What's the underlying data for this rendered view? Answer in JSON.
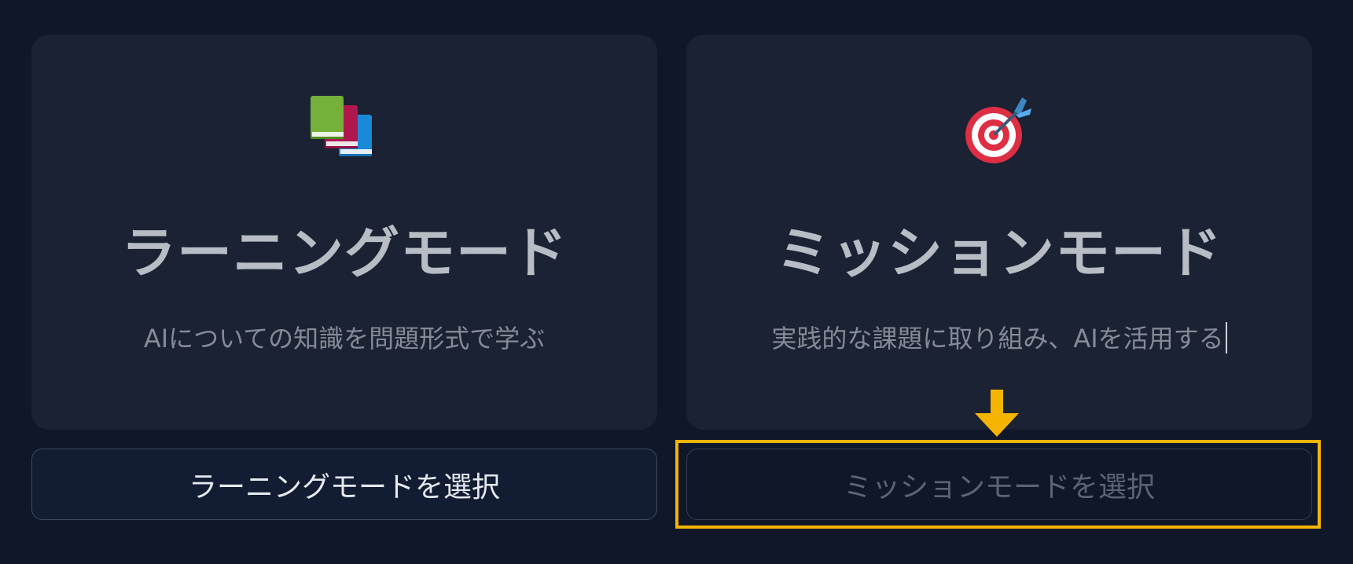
{
  "modes": [
    {
      "id": "learning",
      "icon": "books-icon",
      "title": "ラーニングモード",
      "description": "AIについての知識を問題形式で学ぶ",
      "select_label": "ラーニングモードを選択"
    },
    {
      "id": "mission",
      "icon": "target-dart-icon",
      "title": "ミッションモード",
      "description": "実践的な課題に取り組み、AIを活用する",
      "select_label": "ミッションモードを選択"
    }
  ],
  "colors": {
    "background": "#0f1729",
    "card": "#1a2233",
    "title_text": "#b8bdc5",
    "description_text": "#858b96",
    "highlight": "#f5b400"
  },
  "annotation": {
    "highlight_target": "mission-select-button",
    "arrow_direction": "down"
  }
}
